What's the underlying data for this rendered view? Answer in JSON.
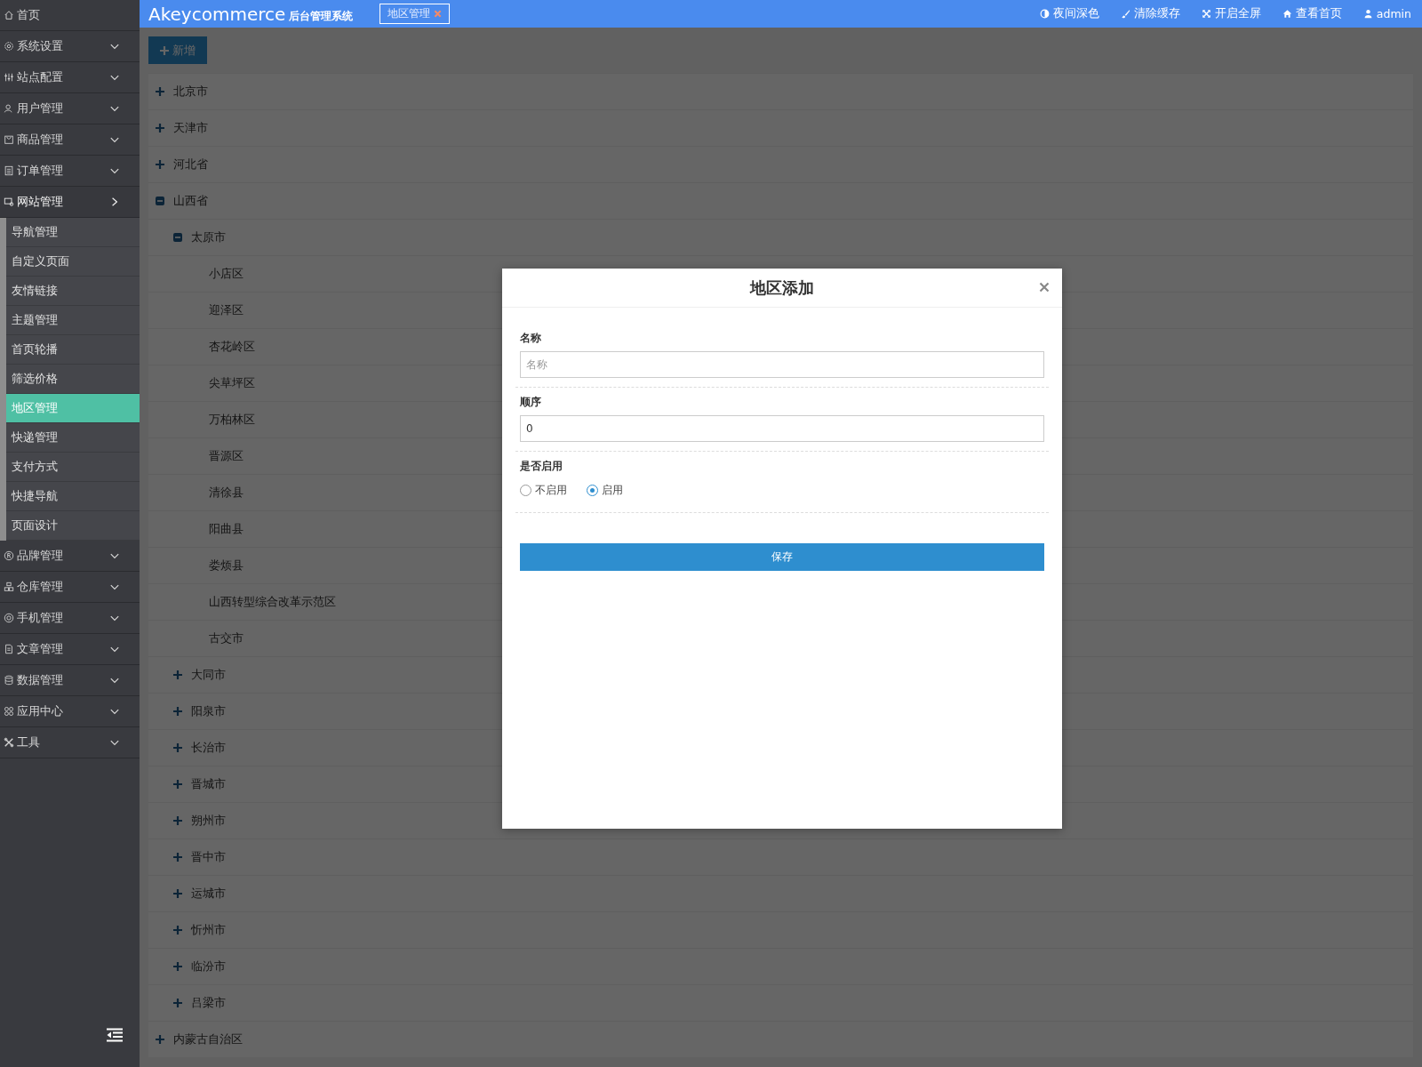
{
  "sidebar": {
    "items": [
      {
        "label": "首页"
      },
      {
        "label": "系统设置",
        "expanded": false
      },
      {
        "label": "站点配置",
        "expanded": false
      },
      {
        "label": "用户管理",
        "expanded": false
      },
      {
        "label": "商品管理",
        "expanded": false
      },
      {
        "label": "订单管理",
        "expanded": false
      },
      {
        "label": "网站管理",
        "expanded": true,
        "children": [
          {
            "label": "导航管理",
            "selected": false
          },
          {
            "label": "自定义页面",
            "selected": false
          },
          {
            "label": "友情链接",
            "selected": false
          },
          {
            "label": "主题管理",
            "selected": false
          },
          {
            "label": "首页轮播",
            "selected": false
          },
          {
            "label": "筛选价格",
            "selected": false
          },
          {
            "label": "地区管理",
            "selected": true
          },
          {
            "label": "快递管理",
            "selected": false
          },
          {
            "label": "支付方式",
            "selected": false
          },
          {
            "label": "快捷导航",
            "selected": false
          },
          {
            "label": "页面设计",
            "selected": false
          }
        ]
      },
      {
        "label": "品牌管理",
        "expanded": false
      },
      {
        "label": "仓库管理",
        "expanded": false
      },
      {
        "label": "手机管理",
        "expanded": false
      },
      {
        "label": "文章管理",
        "expanded": false
      },
      {
        "label": "数据管理",
        "expanded": false
      },
      {
        "label": "应用中心",
        "expanded": false
      },
      {
        "label": "工具",
        "expanded": false
      }
    ]
  },
  "header": {
    "brand": "Akeycommerce",
    "subtitle": "后台管理系统",
    "tab": "地区管理",
    "links": [
      "夜间深色",
      "清除缓存",
      "开启全屏",
      "查看首页",
      "admin"
    ]
  },
  "toolbar": {
    "add_button": "新增"
  },
  "tree": [
    {
      "label": "北京市",
      "expanded": false
    },
    {
      "label": "天津市",
      "expanded": false
    },
    {
      "label": "河北省",
      "expanded": false
    },
    {
      "label": "山西省",
      "expanded": true,
      "children": [
        {
          "label": "太原市",
          "expanded": true,
          "children": [
            {
              "label": "小店区"
            },
            {
              "label": "迎泽区"
            },
            {
              "label": "杏花岭区"
            },
            {
              "label": "尖草坪区"
            },
            {
              "label": "万柏林区"
            },
            {
              "label": "晋源区"
            },
            {
              "label": "清徐县"
            },
            {
              "label": "阳曲县"
            },
            {
              "label": "娄烦县"
            },
            {
              "label": "山西转型综合改革示范区"
            },
            {
              "label": "古交市"
            }
          ]
        },
        {
          "label": "大同市",
          "expanded": false
        },
        {
          "label": "阳泉市",
          "expanded": false
        },
        {
          "label": "长治市",
          "expanded": false
        },
        {
          "label": "晋城市",
          "expanded": false
        },
        {
          "label": "朔州市",
          "expanded": false
        },
        {
          "label": "晋中市",
          "expanded": false
        },
        {
          "label": "运城市",
          "expanded": false
        },
        {
          "label": "忻州市",
          "expanded": false
        },
        {
          "label": "临汾市",
          "expanded": false
        },
        {
          "label": "吕梁市",
          "expanded": false
        }
      ]
    },
    {
      "label": "内蒙古自治区",
      "expanded": false
    }
  ],
  "modal": {
    "title": "地区添加",
    "fields": [
      {
        "kind": "text",
        "label": "名称",
        "placeholder": "名称"
      },
      {
        "kind": "text",
        "label": "顺序",
        "value": "0"
      },
      {
        "kind": "radio",
        "label": "是否启用",
        "options": [
          {
            "label": "不启用",
            "selected": false
          },
          {
            "label": "启用",
            "selected": true
          }
        ]
      }
    ],
    "save_button": "保存"
  }
}
